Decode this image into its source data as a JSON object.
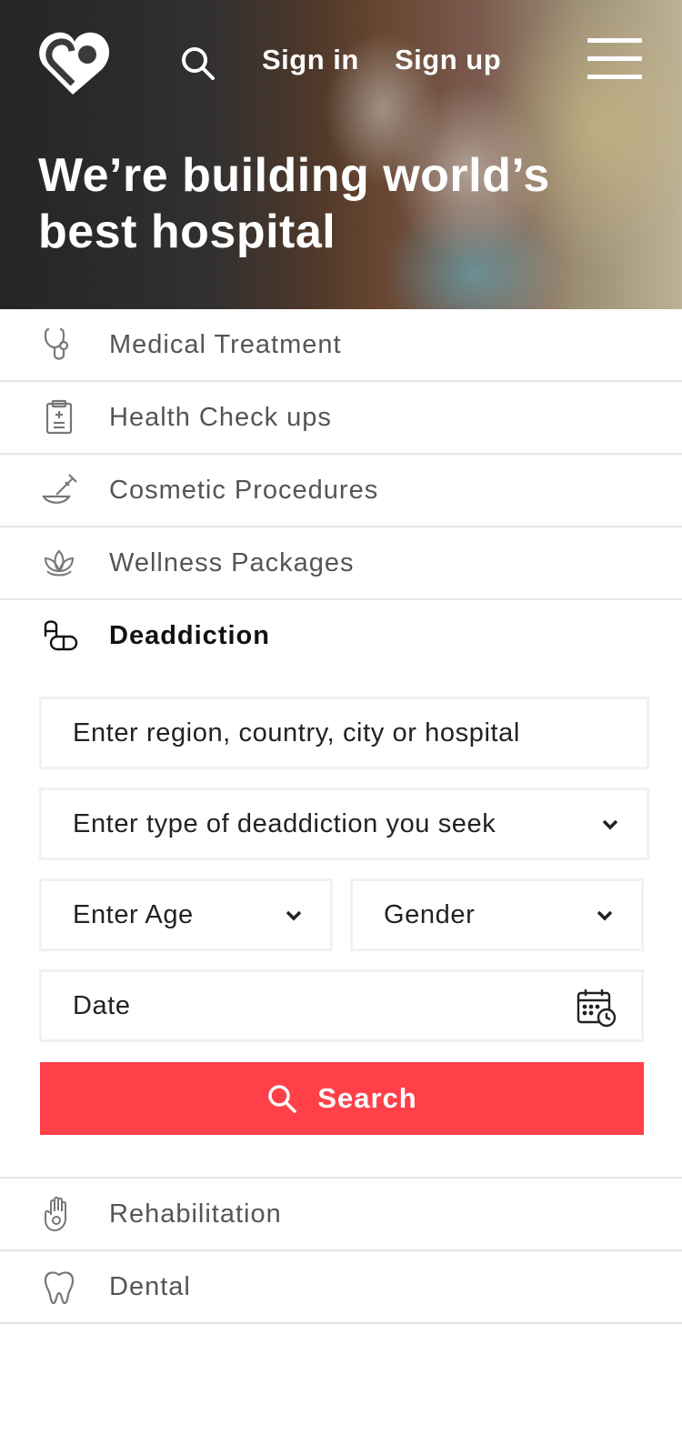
{
  "header": {
    "sign_in": "Sign in",
    "sign_up": "Sign up",
    "logo_icon": "location-pin-heart-logo",
    "search_icon": "search-icon",
    "menu_icon": "hamburger-menu-icon"
  },
  "hero": {
    "title": "We’re building world’s best hospital"
  },
  "categories_top": [
    {
      "label": "Medical Treatment",
      "icon": "stethoscope-icon"
    },
    {
      "label": "Health Check ups",
      "icon": "clipboard-icon"
    },
    {
      "label": "Cosmetic Procedures",
      "icon": "cosmetic-brush-icon"
    },
    {
      "label": "Wellness Packages",
      "icon": "lotus-icon"
    },
    {
      "label": "Deaddiction",
      "icon": "pills-icon",
      "active": true
    }
  ],
  "form": {
    "region_placeholder": "Enter region, country, city or hospital",
    "type_placeholder": "Enter type of deaddiction you seek",
    "age_placeholder": "Enter Age",
    "gender_placeholder": "Gender",
    "date_placeholder": "Date",
    "search_label": "Search"
  },
  "categories_bottom": [
    {
      "label": "Rehabilitation",
      "icon": "hand-icon"
    },
    {
      "label": "Dental",
      "icon": "tooth-icon"
    }
  ],
  "colors": {
    "accent": "#ff4049",
    "divider": "#e6e6e6",
    "text": "#555555"
  }
}
